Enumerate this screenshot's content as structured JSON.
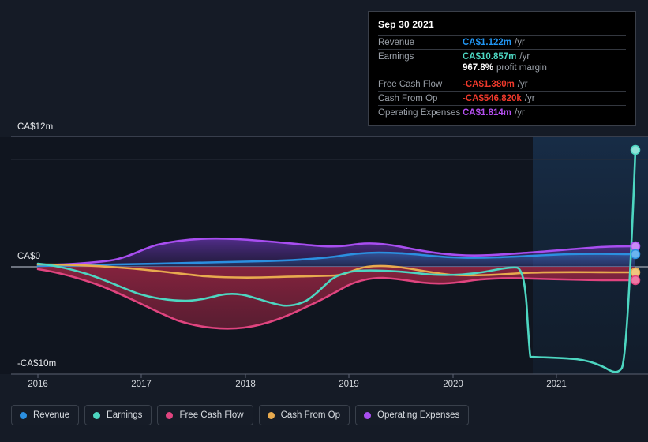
{
  "background": "#151b26",
  "tooltip": {
    "date": "Sep 30 2021",
    "rows": [
      {
        "label": "Revenue",
        "value": "CA$1.122m",
        "unit": "/yr",
        "color": "#2196f3"
      },
      {
        "label": "Earnings",
        "value": "CA$10.857m",
        "unit": "/yr",
        "color": "#4dd6c1"
      },
      {
        "label": "",
        "value": "967.8%",
        "sub": "profit margin",
        "color": "#ffffff"
      },
      {
        "label": "Free Cash Flow",
        "value": "-CA$1.380m",
        "unit": "/yr",
        "color": "#f0392b"
      },
      {
        "label": "Cash From Op",
        "value": "-CA$546.820k",
        "unit": "/yr",
        "color": "#f0392b"
      },
      {
        "label": "Operating Expenses",
        "value": "CA$1.814m",
        "unit": "/yr",
        "color": "#b44ff0"
      }
    ]
  },
  "legend": {
    "items": [
      {
        "label": "Revenue",
        "color": "#2b8fe0"
      },
      {
        "label": "Earnings",
        "color": "#4dd6c1"
      },
      {
        "label": "Free Cash Flow",
        "color": "#e0447f"
      },
      {
        "label": "Cash From Op",
        "color": "#e8aa4e"
      },
      {
        "label": "Operating Expenses",
        "color": "#a84ef0"
      }
    ]
  },
  "axes": {
    "y_top_label": "CA$12m",
    "y_zero_label": "CA$0",
    "y_bottom_label": "-CA$10m",
    "x_labels": [
      "2016",
      "2017",
      "2018",
      "2019",
      "2020",
      "2021"
    ]
  },
  "chart_data": {
    "type": "area",
    "title": "",
    "xlabel": "",
    "ylabel": "CA$",
    "ylim": [
      -10,
      12
    ],
    "ytick_values": [
      12,
      0,
      -10
    ],
    "ytick_labels": [
      "CA$12m",
      "CA$0",
      "-CA$10m"
    ],
    "x": [
      "2016",
      "2017",
      "2018",
      "2019",
      "2020",
      "2021"
    ],
    "xlim": [
      "2015.85",
      "2021.95"
    ],
    "grid": true,
    "legend_position": "bottom-left",
    "forecast_region_start": "2020.8",
    "currency": "CAD",
    "units": "millions",
    "series": [
      {
        "name": "Revenue",
        "color": "#2b8fe0",
        "end_value": 1.122,
        "end_value_label": "CA$1.122m",
        "values": [
          0.1,
          0.12,
          0.15,
          0.18,
          0.22,
          0.25,
          0.28,
          0.32,
          0.45,
          0.75,
          0.95,
          1.05,
          1.02,
          0.98,
          1.0,
          1.05,
          1.02,
          0.95,
          0.9,
          0.92,
          1.0,
          1.08,
          1.12,
          1.122
        ]
      },
      {
        "name": "Earnings",
        "color": "#4dd6c1",
        "end_value": 10.857,
        "end_value_label": "CA$10.857m",
        "values": [
          0.25,
          -0.3,
          -0.85,
          -1.6,
          -2.4,
          -3.1,
          -3.55,
          -3.3,
          -2.9,
          -3.15,
          -3.4,
          -3.2,
          -2.55,
          -1.55,
          -0.95,
          -0.8,
          -0.75,
          -0.65,
          -0.3,
          0.3,
          -9.5,
          -9.7,
          -10.8,
          10.857
        ]
      },
      {
        "name": "Free Cash Flow",
        "color": "#e0447f",
        "end_value": -1.38,
        "end_value_label": "-CA$1.380m",
        "values": [
          -0.2,
          -0.55,
          -1.3,
          -2.5,
          -3.8,
          -4.9,
          -5.4,
          -5.2,
          -4.55,
          -3.45,
          -2.4,
          -1.9,
          -1.75,
          -1.85,
          -2.05,
          -2.0,
          -1.55,
          -1.4,
          -1.45,
          -1.5,
          -1.45,
          -1.42,
          -1.4,
          -1.38
        ]
      },
      {
        "name": "Cash From Op",
        "color": "#e8aa4e",
        "end_value": -0.54682,
        "end_value_label": "-CA$546.820k",
        "values": [
          0.15,
          0.1,
          0.0,
          -0.2,
          -0.45,
          -0.7,
          -0.85,
          -0.95,
          -1.05,
          -1.15,
          -1.25,
          -1.3,
          -1.1,
          -0.3,
          -0.22,
          -0.28,
          -0.4,
          -0.62,
          -0.7,
          -0.72,
          -0.62,
          -0.56,
          -0.55,
          -0.54682
        ]
      },
      {
        "name": "Operating Expenses",
        "color": "#a84ef0",
        "end_value": 1.814,
        "end_value_label": "CA$1.814m",
        "values": [
          0.2,
          0.22,
          0.25,
          0.55,
          1.1,
          1.6,
          1.95,
          2.05,
          2.05,
          1.95,
          1.75,
          1.55,
          1.45,
          1.55,
          1.85,
          1.95,
          1.8,
          1.5,
          1.4,
          1.45,
          1.6,
          1.72,
          1.8,
          1.814
        ]
      }
    ]
  }
}
